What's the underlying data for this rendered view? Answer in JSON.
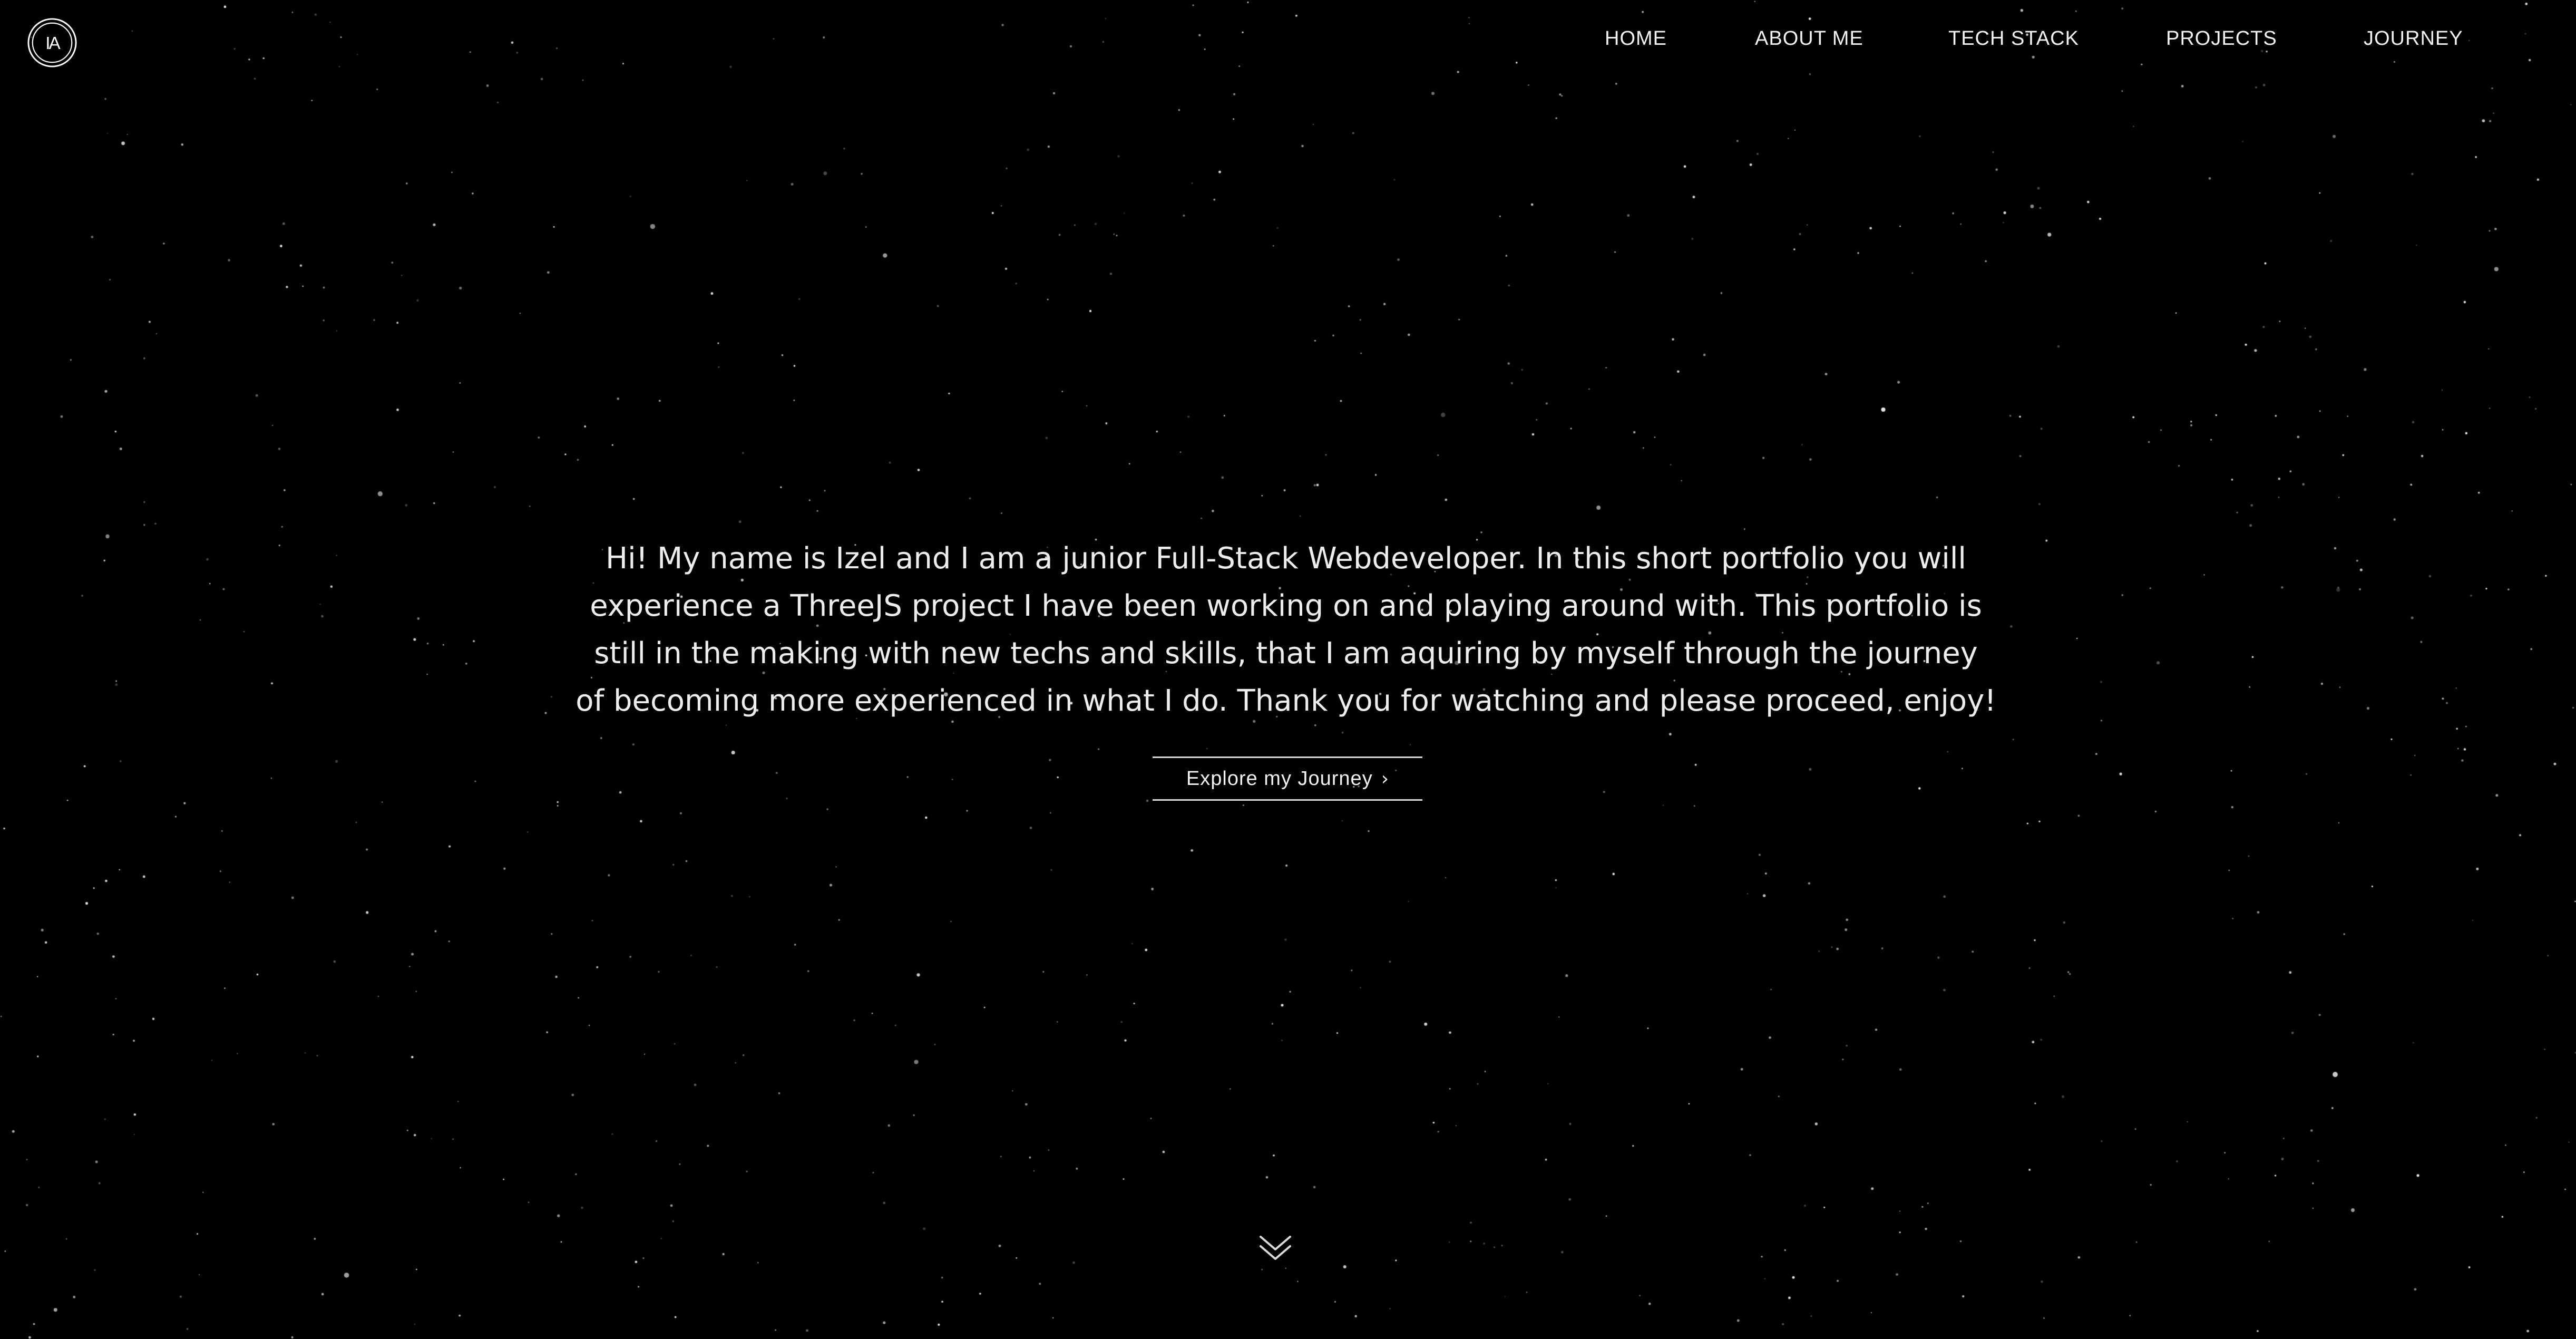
{
  "logo": {
    "initials": "IA"
  },
  "nav": {
    "items": [
      {
        "label": "HOME"
      },
      {
        "label": "ABOUT ME"
      },
      {
        "label": "TECH STACK"
      },
      {
        "label": "PROJECTS"
      },
      {
        "label": "JOURNEY"
      }
    ]
  },
  "intro": {
    "lines": [
      "Hi! My name is Izel and I am a junior Full-Stack Webdeveloper. In this short portfolio you will",
      "experience a ThreeJS project I have been working on and playing around with. This portfolio is",
      "still in the making with new techs and skills, that I am aquiring by myself through the journey",
      "of becoming more experienced in what I do. Thank you for watching and please proceed, enjoy!"
    ]
  },
  "cta": {
    "label": "Explore my Journey",
    "arrow": "›"
  },
  "icons": {
    "logo": "ia-monogram-icon",
    "scroll": "double-chevron-down-icon",
    "cta_arrow": "chevron-right-icon"
  },
  "colors": {
    "background": "#000000",
    "text": "#ededed",
    "accent": "#ffffff"
  }
}
